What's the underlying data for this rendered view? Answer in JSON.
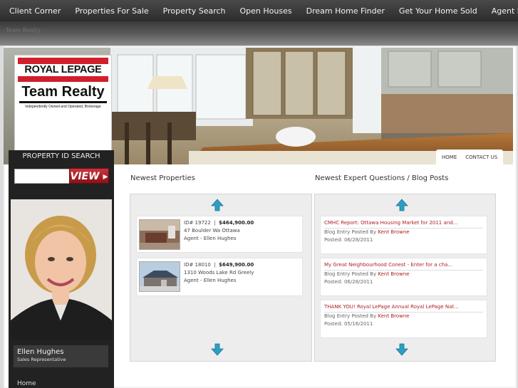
{
  "nav": [
    {
      "label": "Client Corner"
    },
    {
      "label": "Properties For Sale"
    },
    {
      "label": "Property Search"
    },
    {
      "label": "Open Houses"
    },
    {
      "label": "Dream Home Finder"
    },
    {
      "label": "Get Your Home Sold"
    },
    {
      "label": "Agent Blogs"
    }
  ],
  "breadcrumb": "Team Realty",
  "logo": {
    "line1": "ROYAL LEPAGE",
    "line2": "Team Realty",
    "tagline": "Independently Owned and Operated, Brokerage"
  },
  "subnav": {
    "home": "HOME",
    "contact": "CONTACT US"
  },
  "search": {
    "title": "PROPERTY ID SEARCH",
    "button": "VIEW",
    "value": ""
  },
  "agent": {
    "name": "Ellen Hughes",
    "role": "Sales Representative"
  },
  "sidebar_menu": {
    "home": "Home"
  },
  "properties": {
    "title": "Newest Properties",
    "items": [
      {
        "id": "ID# 19722",
        "price": "$464,900.00",
        "address": "47 Boulder Wa Ottawa",
        "agent": "Agent - Ellen Hughes"
      },
      {
        "id": "ID# 18010",
        "price": "$649,900.00",
        "address": "1310 Woods Lake Rd Greely",
        "agent": "Agent - Ellen Hughes"
      }
    ]
  },
  "blog": {
    "title": "Newest Expert Questions / Blog Posts",
    "posted_by": "Blog Entry Posted By",
    "posts": [
      {
        "title": "CMHC Report: Ottawa Housing Market for 2011 and...",
        "author": "Kent Browne",
        "date": "Posted: 06/28/2011"
      },
      {
        "title": "My Great Neighbourhood Conest - Enter for a cha...",
        "author": "Kent Browne",
        "date": "Posted: 06/28/2011"
      },
      {
        "title": "THANK YOU! Royal LePage Annual Royal LePage Nat...",
        "author": "Kent Browne",
        "date": "Posted: 05/16/2011"
      }
    ]
  },
  "colors": {
    "brand_red": "#d21e2b",
    "link_red": "#b01e25",
    "arrow_teal": "#2e9fc4",
    "nav_bg": "#333333"
  },
  "icons": [
    "scroll-up-arrow-icon",
    "scroll-down-arrow-icon"
  ]
}
